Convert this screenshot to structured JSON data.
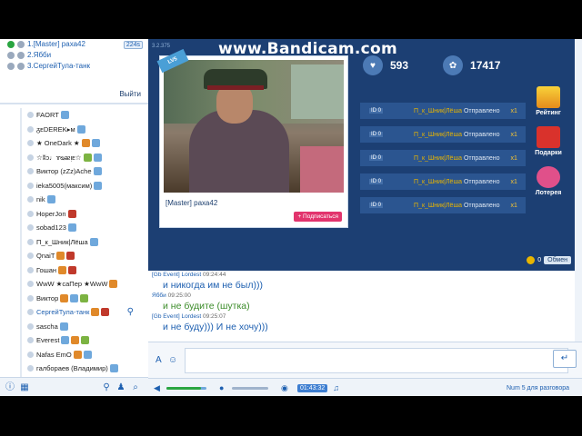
{
  "watermark": "www.Bandicam.com",
  "queue": {
    "items": [
      "1.[Master] раха42",
      "2.Ябби",
      "3.СергейТула-танк"
    ],
    "count_badge": "224s",
    "exit_label": "Выйти"
  },
  "users": [
    {
      "name": "FAORT"
    },
    {
      "name": "ᵹᴇDEREK▸ᴍ"
    },
    {
      "name": "★ OneDark ★"
    },
    {
      "name": "☆ʬᴐ♩ɤᴓᴂᴉᴇ☆"
    },
    {
      "name": "Виктор (zZz)Ache"
    },
    {
      "name": "ieka5005(максим)"
    },
    {
      "name": "nik"
    },
    {
      "name": "HoperJon"
    },
    {
      "name": "sobad123"
    },
    {
      "name": "П_к_Шник|Лёша"
    },
    {
      "name": "QnaiT"
    },
    {
      "name": "Гошан"
    },
    {
      "name": "WwW ★саПер ★WwW"
    },
    {
      "name": "Виктор"
    },
    {
      "name": "СергейТула-танк"
    },
    {
      "name": "sascha"
    },
    {
      "name": "Everest"
    },
    {
      "name": "Nafas EmO"
    },
    {
      "name": "галбораев (Владимир)"
    }
  ],
  "stage": {
    "version": "3.2.375",
    "level_badge": "LV5",
    "streamer_name": "[Master] раха42",
    "subscribe_label": "+ Подписаться",
    "hearts": "593",
    "gifts_total": "17417",
    "gift_rows": [
      {
        "tag": "ID 0",
        "user": "П_к_Шник|Лёша",
        "status": "Отправлено",
        "count": "x1"
      },
      {
        "tag": "ID 0",
        "user": "П_к_Шник|Лёша",
        "status": "Отправлено",
        "count": "x1"
      },
      {
        "tag": "ID 0",
        "user": "П_к_Шник|Лёша",
        "status": "Отправлено",
        "count": "x1"
      },
      {
        "tag": "ID 0",
        "user": "П_к_Шник|Лёша",
        "status": "Отправлено",
        "count": "x1"
      },
      {
        "tag": "ID 0",
        "user": "П_к_Шник|Лёша",
        "status": "Отправлено",
        "count": "x1"
      }
    ],
    "side_buttons": {
      "rating": "Рейтинг",
      "gifts": "Подарки",
      "lottery": "Лотерея"
    },
    "coins": "0",
    "exchange_label": "Обмен"
  },
  "chat": {
    "messages": [
      {
        "author": "[Gb Event] Lordest",
        "time": "09:24:44",
        "text": "и никогда им не был)))",
        "green": false
      },
      {
        "author": "Ябби",
        "time": "09:25:00",
        "text": "и не будите (шутка)",
        "green": true
      },
      {
        "author": "[Gb Event] Lordest",
        "time": "09:25:07",
        "text": "и не буду))) И не хочу)))",
        "green": false
      }
    ],
    "input_value": ""
  },
  "bottombar": {
    "timer": "01:43:32",
    "mode": "Num 5 для разговора"
  },
  "colors": {
    "stage_bg": "#1c3f73",
    "accent": "#1d5fb0",
    "gift_user": "#e8b500",
    "subscribe": "#e2346d"
  }
}
